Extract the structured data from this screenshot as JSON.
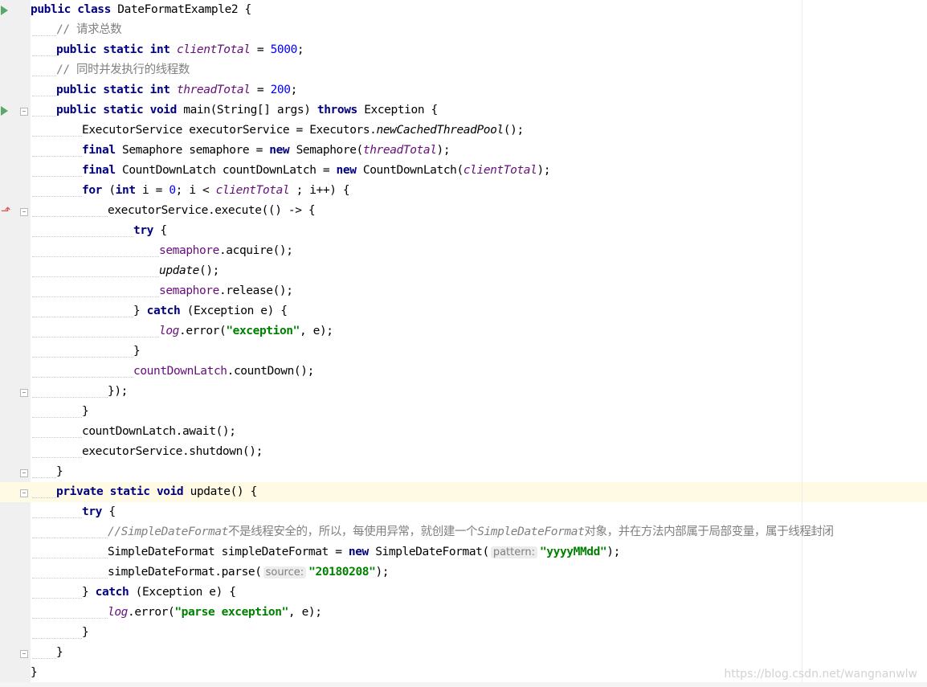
{
  "editor": {
    "lines": [
      {
        "indent": 0,
        "tokens": [
          [
            "kw",
            "public class "
          ],
          [
            "",
            "DateFormatExample2 {"
          ]
        ]
      },
      {
        "indent": 1,
        "tokens": [
          [
            "cm",
            "// 请求总数"
          ]
        ]
      },
      {
        "indent": 1,
        "tokens": [
          [
            "kw",
            "public static int "
          ],
          [
            "sf",
            "clientTotal"
          ],
          [
            "",
            " = "
          ],
          [
            "num",
            "5000"
          ],
          [
            "",
            ";"
          ]
        ]
      },
      {
        "indent": 1,
        "tokens": [
          [
            "cm",
            "// 同时并发执行的线程数"
          ]
        ]
      },
      {
        "indent": 1,
        "tokens": [
          [
            "kw",
            "public static int "
          ],
          [
            "sf",
            "threadTotal"
          ],
          [
            "",
            " = "
          ],
          [
            "num",
            "200"
          ],
          [
            "",
            ";"
          ]
        ]
      },
      {
        "indent": 1,
        "tokens": [
          [
            "kw",
            "public static void "
          ],
          [
            "",
            "main(String[] args) "
          ],
          [
            "kw",
            "throws "
          ],
          [
            "",
            "Exception {"
          ]
        ]
      },
      {
        "indent": 2,
        "tokens": [
          [
            "",
            "ExecutorService executorService = Executors."
          ],
          [
            "si",
            "newCachedThreadPool"
          ],
          [
            "",
            "();"
          ]
        ]
      },
      {
        "indent": 2,
        "tokens": [
          [
            "kw",
            "final "
          ],
          [
            "",
            "Semaphore semaphore = "
          ],
          [
            "kw",
            "new "
          ],
          [
            "",
            "Semaphore("
          ],
          [
            "sf",
            "threadTotal"
          ],
          [
            "",
            ");"
          ]
        ]
      },
      {
        "indent": 2,
        "tokens": [
          [
            "kw",
            "final "
          ],
          [
            "",
            "CountDownLatch countDownLatch = "
          ],
          [
            "kw",
            "new "
          ],
          [
            "",
            "CountDownLatch("
          ],
          [
            "sf",
            "clientTotal"
          ],
          [
            "",
            ");"
          ]
        ]
      },
      {
        "indent": 2,
        "tokens": [
          [
            "kw",
            "for "
          ],
          [
            "",
            "("
          ],
          [
            "kw",
            "int "
          ],
          [
            "",
            "i = "
          ],
          [
            "num",
            "0"
          ],
          [
            "",
            "; i < "
          ],
          [
            "sf",
            "clientTotal"
          ],
          [
            "",
            " ; i++) {"
          ]
        ]
      },
      {
        "indent": 3,
        "tokens": [
          [
            "",
            "executorService.execute(() -> {"
          ]
        ]
      },
      {
        "indent": 4,
        "tokens": [
          [
            "kw",
            "try "
          ],
          [
            "",
            "{"
          ]
        ]
      },
      {
        "indent": 5,
        "tokens": [
          [
            "fld",
            "semaphore"
          ],
          [
            "",
            ".acquire();"
          ]
        ]
      },
      {
        "indent": 5,
        "tokens": [
          [
            "si",
            "update"
          ],
          [
            "",
            "();"
          ]
        ]
      },
      {
        "indent": 5,
        "tokens": [
          [
            "fld",
            "semaphore"
          ],
          [
            "",
            ".release();"
          ]
        ]
      },
      {
        "indent": 4,
        "tokens": [
          [
            "",
            "} "
          ],
          [
            "kw",
            "catch "
          ],
          [
            "",
            "(Exception e) {"
          ]
        ]
      },
      {
        "indent": 5,
        "tokens": [
          [
            "sf",
            "log"
          ],
          [
            "",
            ".error("
          ],
          [
            "str",
            "\"exception\""
          ],
          [
            "",
            ", e);"
          ]
        ]
      },
      {
        "indent": 4,
        "tokens": [
          [
            "",
            "}"
          ]
        ]
      },
      {
        "indent": 4,
        "tokens": [
          [
            "fld",
            "countDownLatch"
          ],
          [
            "",
            ".countDown();"
          ]
        ]
      },
      {
        "indent": 3,
        "tokens": [
          [
            "",
            "});"
          ]
        ]
      },
      {
        "indent": 2,
        "tokens": [
          [
            "",
            "}"
          ]
        ]
      },
      {
        "indent": 2,
        "tokens": [
          [
            "",
            "countDownLatch.await();"
          ]
        ]
      },
      {
        "indent": 2,
        "tokens": [
          [
            "",
            "executorService.shutdown();"
          ]
        ]
      },
      {
        "indent": 1,
        "tokens": [
          [
            "",
            "}"
          ]
        ]
      },
      {
        "indent": 1,
        "tokens": [
          [
            "kw",
            "private static void "
          ],
          [
            "",
            "update() {"
          ]
        ]
      },
      {
        "indent": 2,
        "tokens": [
          [
            "kw",
            "try "
          ],
          [
            "",
            "{"
          ]
        ]
      },
      {
        "indent": 3,
        "tokens": [
          [
            "cmi",
            "//SimpleDateFormat"
          ],
          [
            "cm",
            "不是线程安全的，所以，每使用异常，就创建一个"
          ],
          [
            "cmi",
            "SimpleDateFormat"
          ],
          [
            "cm",
            "对象，并在方法内部属于局部变量，属于线程封闭"
          ]
        ]
      },
      {
        "indent": 3,
        "tokens": [
          [
            "",
            "SimpleDateFormat simpleDateFormat = "
          ],
          [
            "kw",
            "new "
          ],
          [
            "",
            "SimpleDateFormat("
          ],
          [
            "hint",
            "pattern:"
          ],
          [
            "str",
            "\"yyyyMMdd\""
          ],
          [
            "",
            ");"
          ]
        ]
      },
      {
        "indent": 3,
        "tokens": [
          [
            "",
            "simpleDateFormat.parse("
          ],
          [
            "hint",
            "source:"
          ],
          [
            "str",
            "\"20180208\""
          ],
          [
            "",
            ");"
          ]
        ]
      },
      {
        "indent": 2,
        "tokens": [
          [
            "",
            "} "
          ],
          [
            "kw",
            "catch "
          ],
          [
            "",
            "(Exception e) {"
          ]
        ]
      },
      {
        "indent": 3,
        "tokens": [
          [
            "sf",
            "log"
          ],
          [
            "",
            ".error("
          ],
          [
            "str",
            "\"parse exception\""
          ],
          [
            "",
            ", e);"
          ]
        ]
      },
      {
        "indent": 2,
        "tokens": [
          [
            "",
            "}"
          ]
        ]
      },
      {
        "indent": 1,
        "tokens": [
          [
            "",
            "}"
          ]
        ]
      },
      {
        "indent": 0,
        "tokens": [
          [
            "",
            "}"
          ]
        ]
      }
    ]
  },
  "gutter": {
    "run_icon": "run-icon",
    "fold_icon": "fold-icon",
    "override_icon": "override-arrow-icon",
    "override_glyph": "⬏",
    "run_color": "#59a869",
    "override_color": "#d9534f"
  },
  "watermark": "https://blog.csdn.net/wangnanwlw"
}
